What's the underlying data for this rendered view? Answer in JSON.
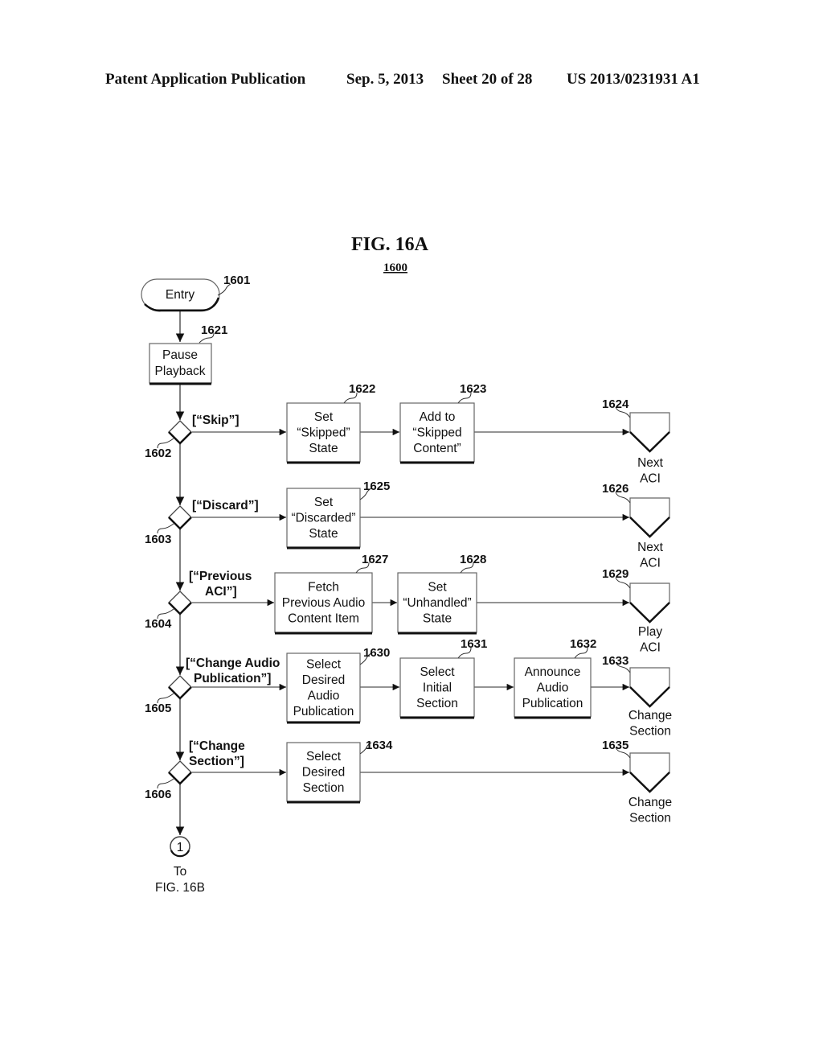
{
  "header": {
    "publication": "Patent Application Publication",
    "date": "Sep. 5, 2013",
    "sheet": "Sheet 20 of 28",
    "patent_number": "US 2013/0231931 A1"
  },
  "figure": {
    "title": "FIG. 16A",
    "number": "1600"
  },
  "entry": {
    "label": "Entry",
    "ref": "1601"
  },
  "pause": {
    "lines": [
      "Pause",
      "Playback"
    ],
    "ref": "1621"
  },
  "decisions": [
    {
      "ref": "1602",
      "condition": [
        "[“Skip”]"
      ]
    },
    {
      "ref": "1603",
      "condition": [
        "[“Discard”]"
      ]
    },
    {
      "ref": "1604",
      "condition": [
        "[“Previous",
        "ACI”]"
      ]
    },
    {
      "ref": "1605",
      "condition": [
        "[“Change Audio",
        "Publication”]"
      ]
    },
    {
      "ref": "1606",
      "condition": [
        "[“Change",
        "Section”]"
      ]
    }
  ],
  "processes": {
    "p1622": {
      "ref": "1622",
      "lines": [
        "Set",
        "“Skipped”",
        "State"
      ]
    },
    "p1623": {
      "ref": "1623",
      "lines": [
        "Add to",
        "“Skipped",
        "Content”"
      ]
    },
    "p1625": {
      "ref": "1625",
      "lines": [
        "Set",
        "“Discarded”",
        "State"
      ]
    },
    "p1627": {
      "ref": "1627",
      "lines": [
        "Fetch",
        "Previous Audio",
        "Content Item"
      ]
    },
    "p1628": {
      "ref": "1628",
      "lines": [
        "Set",
        "“Unhandled”",
        "State"
      ]
    },
    "p1630": {
      "ref": "1630",
      "lines": [
        "Select",
        "Desired",
        "Audio",
        "Publication"
      ]
    },
    "p1631": {
      "ref": "1631",
      "lines": [
        "Select",
        "Initial",
        "Section"
      ]
    },
    "p1632": {
      "ref": "1632",
      "lines": [
        "Announce",
        "Audio",
        "Publication"
      ]
    },
    "p1634": {
      "ref": "1634",
      "lines": [
        "Select",
        "Desired",
        "Section"
      ]
    }
  },
  "terminals": {
    "t1624": {
      "ref": "1624",
      "lines": [
        "Next",
        "ACI"
      ]
    },
    "t1626": {
      "ref": "1626",
      "lines": [
        "Next",
        "ACI"
      ]
    },
    "t1629": {
      "ref": "1629",
      "lines": [
        "Play",
        "ACI"
      ]
    },
    "t1633": {
      "ref": "1633",
      "lines": [
        "Change",
        "Section"
      ]
    },
    "t1635": {
      "ref": "1635",
      "lines": [
        "Change",
        "Section"
      ]
    }
  },
  "connector": {
    "label": "1",
    "to": [
      "To",
      "FIG. 16B"
    ]
  }
}
